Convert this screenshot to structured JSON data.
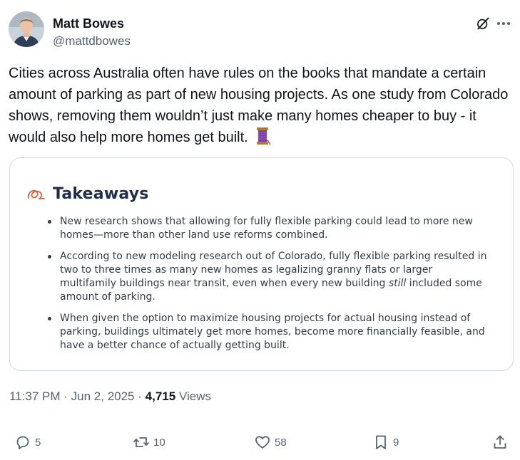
{
  "author": {
    "name": "Matt Bowes",
    "handle": "@mattdbowes"
  },
  "header_icons": [
    "grok-icon",
    "more-icon"
  ],
  "tweet": {
    "text": "Cities across Australia often have rules on the books that mandate a certain amount of parking as part of new housing projects. As one study from Colorado shows, removing them wouldn’t just make many homes cheaper to buy - it would also help more homes get built.",
    "emoji": "spool-of-thread"
  },
  "card": {
    "title": "Takeaways",
    "items": [
      {
        "text": "New research shows that allowing for fully flexible parking could lead to more new homes—more than other land use reforms combined."
      },
      {
        "text_before": "According to new modeling research out of Colorado, fully flexible parking resulted in two to three times as many new homes as legalizing granny flats or larger multifamily buildings near transit, even when every new building ",
        "emphasis": "still",
        "text_after": " included some amount of parking."
      },
      {
        "text": "When given the option to maximize housing projects for actual housing instead of parking, buildings ultimately get more homes, become more financially feasible, and have a better chance of actually getting built."
      }
    ]
  },
  "meta": {
    "time": "11:37 PM",
    "date": "Jun 2, 2025",
    "separator": "·",
    "views_count": "4,715",
    "views_label": "Views"
  },
  "actions": {
    "replies": "5",
    "reposts": "10",
    "likes": "58",
    "bookmarks": "9"
  },
  "colors": {
    "text": "#0f1419",
    "secondary": "#536471",
    "card_border": "#cfd9de",
    "card_title": "#1f2d46"
  }
}
